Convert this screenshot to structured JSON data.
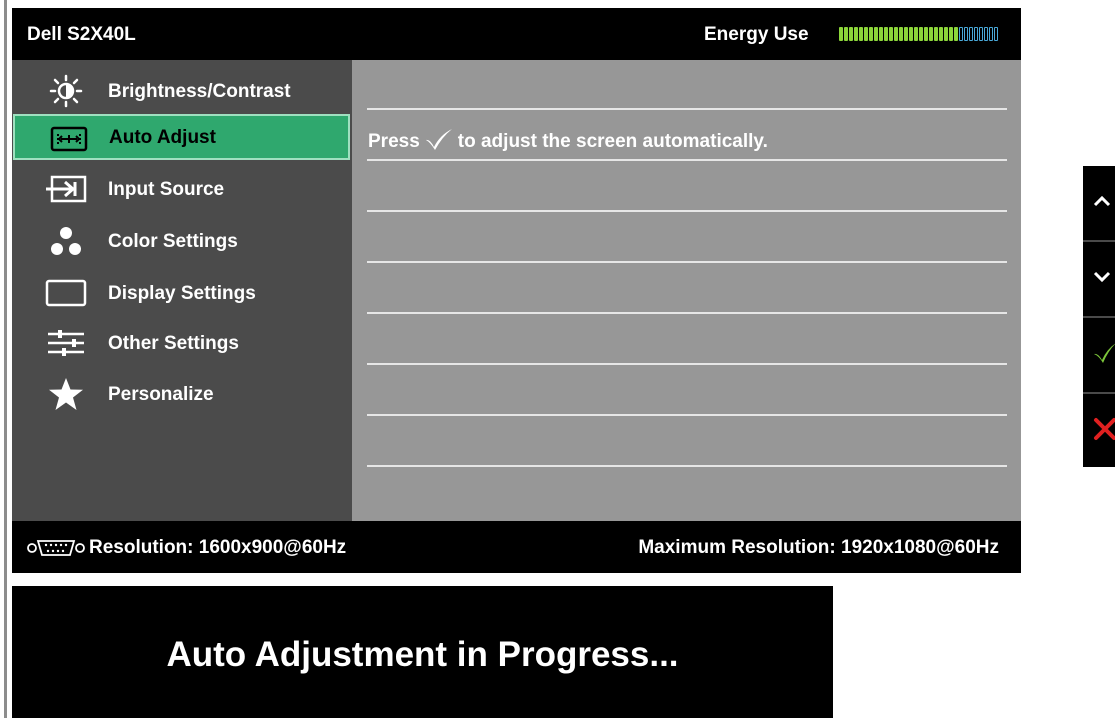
{
  "osd": {
    "model": "Dell S2X40L",
    "energy_label": "Energy Use",
    "energy_level": 0.75,
    "menu": [
      {
        "label": "Brightness/Contrast",
        "icon": "brightness-icon",
        "active": false
      },
      {
        "label": "Auto Adjust",
        "icon": "auto-adjust-icon",
        "active": true
      },
      {
        "label": "Input Source",
        "icon": "input-source-icon",
        "active": false
      },
      {
        "label": "Color Settings",
        "icon": "color-settings-icon",
        "active": false
      },
      {
        "label": "Display Settings",
        "icon": "display-settings-icon",
        "active": false
      },
      {
        "label": "Other Settings",
        "icon": "other-settings-icon",
        "active": false
      },
      {
        "label": "Personalize",
        "icon": "star-icon",
        "active": false
      }
    ],
    "content": {
      "press_text": "Press",
      "instruction": "to adjust the screen automatically."
    },
    "footer": {
      "resolution": "Resolution: 1600x900@60Hz",
      "max_resolution": "Maximum Resolution: 1920x1080@60Hz"
    }
  },
  "progress": {
    "message": "Auto Adjustment in Progress..."
  },
  "buttons": [
    {
      "name": "up-arrow-icon"
    },
    {
      "name": "down-arrow-icon"
    },
    {
      "name": "checkmark-icon"
    },
    {
      "name": "close-icon"
    }
  ],
  "colors": {
    "active_bg": "#2fa86e",
    "energy_on": "#8cd63a",
    "energy_off": "#4aa8d8",
    "menu_bg": "#4b4b4b",
    "content_bg": "#979797"
  }
}
